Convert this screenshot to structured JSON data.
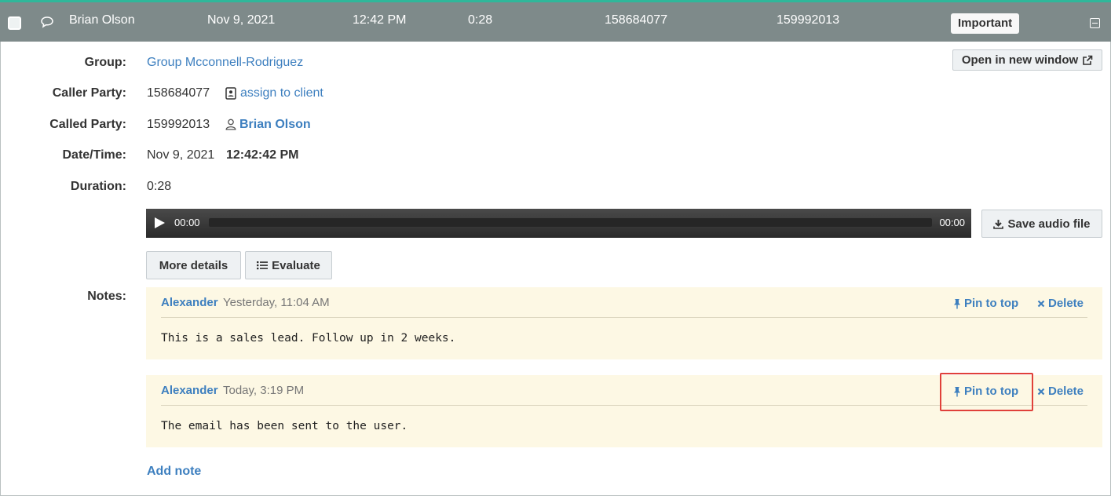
{
  "header": {
    "name": "Brian Olson",
    "date": "Nov 9, 2021",
    "time": "12:42 PM",
    "duration": "0:28",
    "caller": "158684077",
    "called": "159992013",
    "badge": "Important"
  },
  "actions": {
    "open_new_window": "Open in new window",
    "save_audio": "Save audio file",
    "more_details": "More details",
    "evaluate": "Evaluate",
    "add_note": "Add note"
  },
  "fields": {
    "group_label": "Group:",
    "group_value": "Group Mcconnell-Rodriguez",
    "caller_label": "Caller Party:",
    "caller_value": "158684077",
    "assign_link": "assign to client",
    "called_label": "Called Party:",
    "called_value": "159992013",
    "called_name": "Brian Olson",
    "datetime_label": "Date/Time:",
    "date_value": "Nov 9, 2021",
    "time_value": "12:42:42 PM",
    "duration_label": "Duration:",
    "duration_value": "0:28",
    "notes_label": "Notes:"
  },
  "player": {
    "current": "00:00",
    "total": "00:00"
  },
  "notes": [
    {
      "author": "Alexander",
      "time": "Yesterday, 11:04 AM",
      "text": "This is a sales lead. Follow up in 2 weeks.",
      "pin_label": "Pin to top",
      "delete_label": "Delete"
    },
    {
      "author": "Alexander",
      "time": "Today, 3:19 PM",
      "text": "The email has been sent to the user.",
      "pin_label": "Pin to top",
      "delete_label": "Delete"
    }
  ],
  "colors": {
    "header_bg": "#7e8a8a",
    "header_accent": "#2fb79a",
    "link": "#3d7fbf",
    "note_bg": "#fdf8e4",
    "highlight": "#e0403a"
  }
}
